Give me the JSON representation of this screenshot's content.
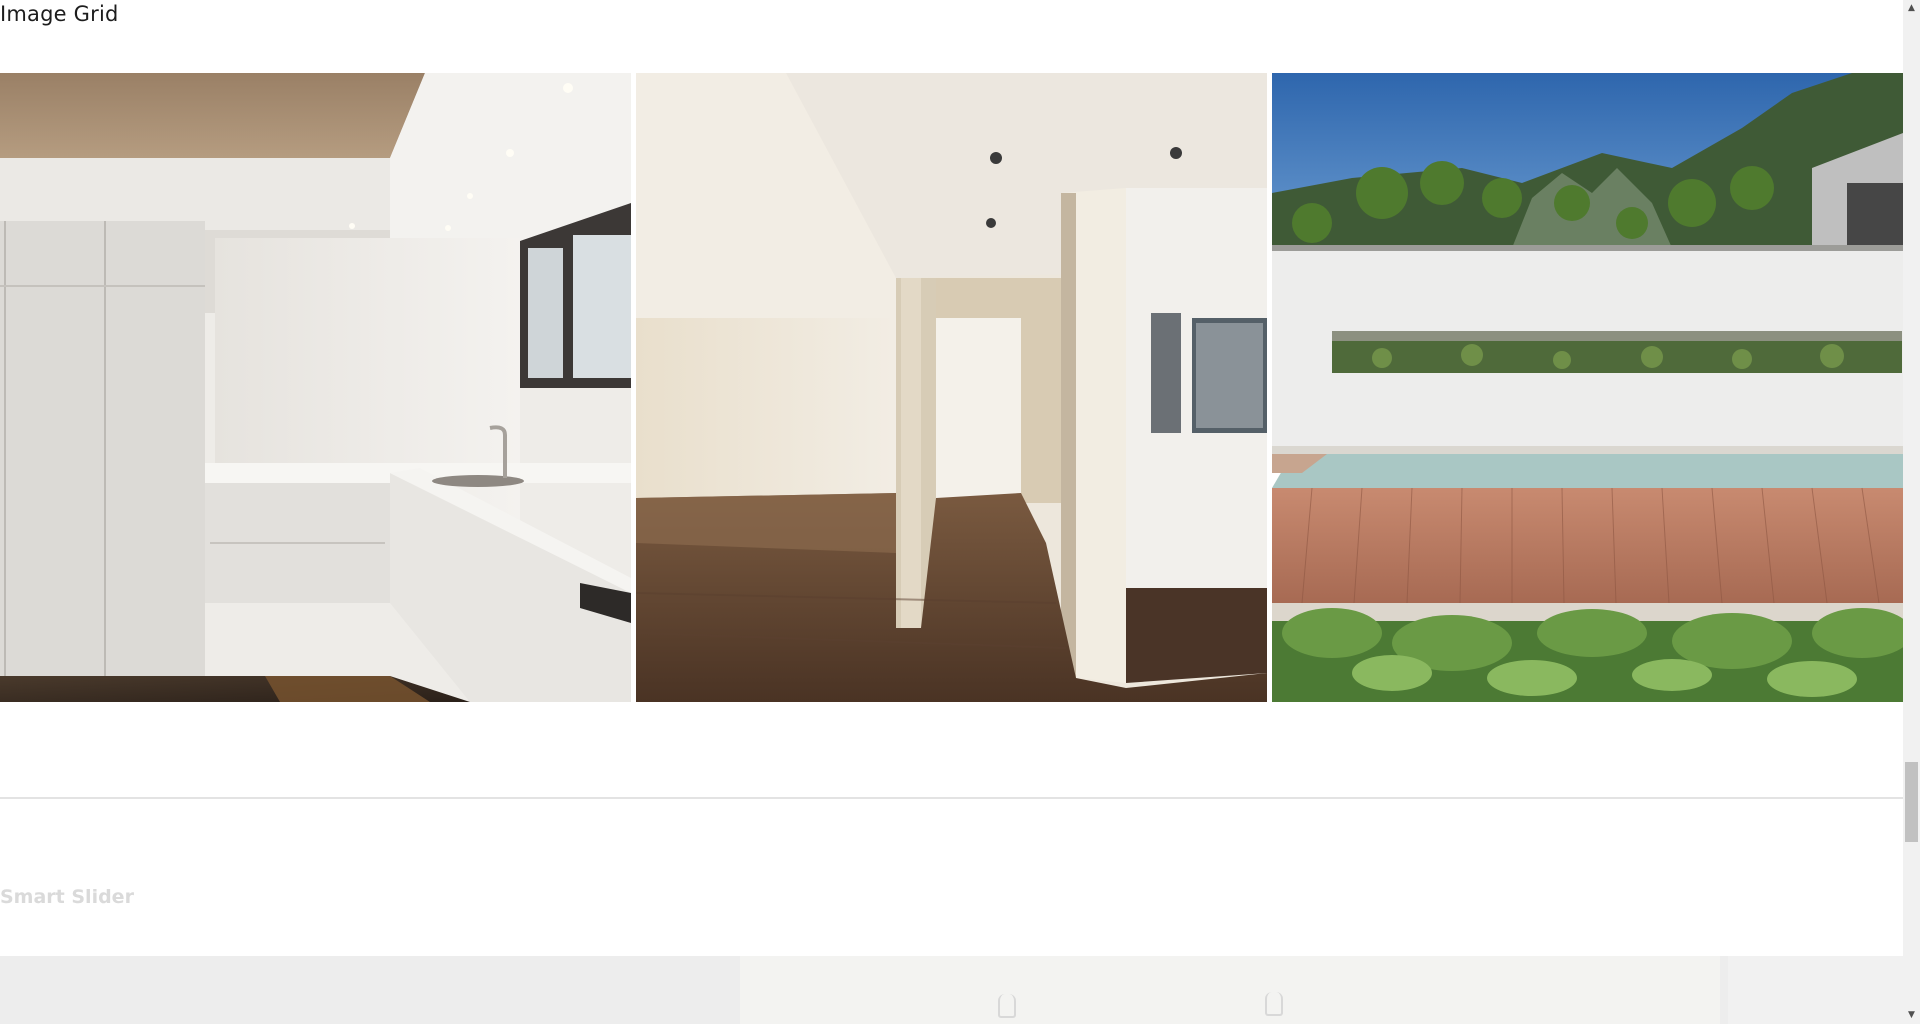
{
  "image_grid": {
    "title": "Image Grid",
    "images": [
      {
        "subject": "modern white kitchen interior"
      },
      {
        "subject": "empty room with wooden floor and partition wall"
      },
      {
        "subject": "pool terrace with wooden deck and mountains"
      }
    ]
  },
  "smart_slider": {
    "title": "Smart Slider"
  },
  "scrollbar": {
    "up_icon": "▲",
    "down_icon": "▼"
  },
  "colors": {
    "title_text": "#1d1d1d",
    "slider_title_text": "#dadada",
    "divider": "#e3e3e3",
    "slider_background": "#f1f1f1"
  }
}
